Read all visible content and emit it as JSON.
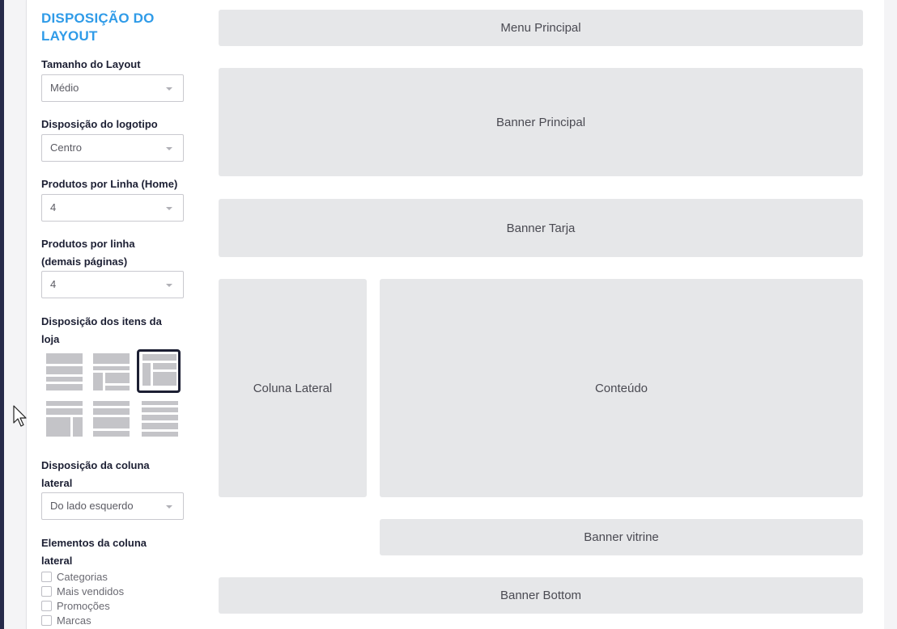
{
  "panel": {
    "title": "DISPOSIÇÃO DO LAYOUT",
    "layout_size": {
      "label": "Tamanho do Layout",
      "value": "Médio"
    },
    "logo_position": {
      "label": "Disposição do logotipo",
      "value": "Centro"
    },
    "products_home": {
      "label": "Produtos por Linha (Home)",
      "value": "4"
    },
    "products_other": {
      "label": "Produtos por linha (demais páginas)",
      "value": "4"
    },
    "store_items": {
      "label": "Disposição dos itens da loja",
      "selected_option": 3
    },
    "sidebar_position": {
      "label": "Disposição da coluna lateral",
      "value": "Do lado esquerdo"
    },
    "sidebar_elements": {
      "label": "Elementos da coluna lateral",
      "items": [
        "Categorias",
        "Mais vendidos",
        "Promoções",
        "Marcas"
      ]
    }
  },
  "preview": {
    "menu": "Menu Principal",
    "banner_main": "Banner Principal",
    "banner_stripe": "Banner Tarja",
    "sidebar": "Coluna Lateral",
    "content": "Conteúdo",
    "banner_showcase": "Banner vitrine",
    "banner_bottom": "Banner Bottom"
  },
  "colors": {
    "accent": "#2f9be8",
    "dark": "#1c1f33",
    "section_bg": "#e6e7e9"
  }
}
